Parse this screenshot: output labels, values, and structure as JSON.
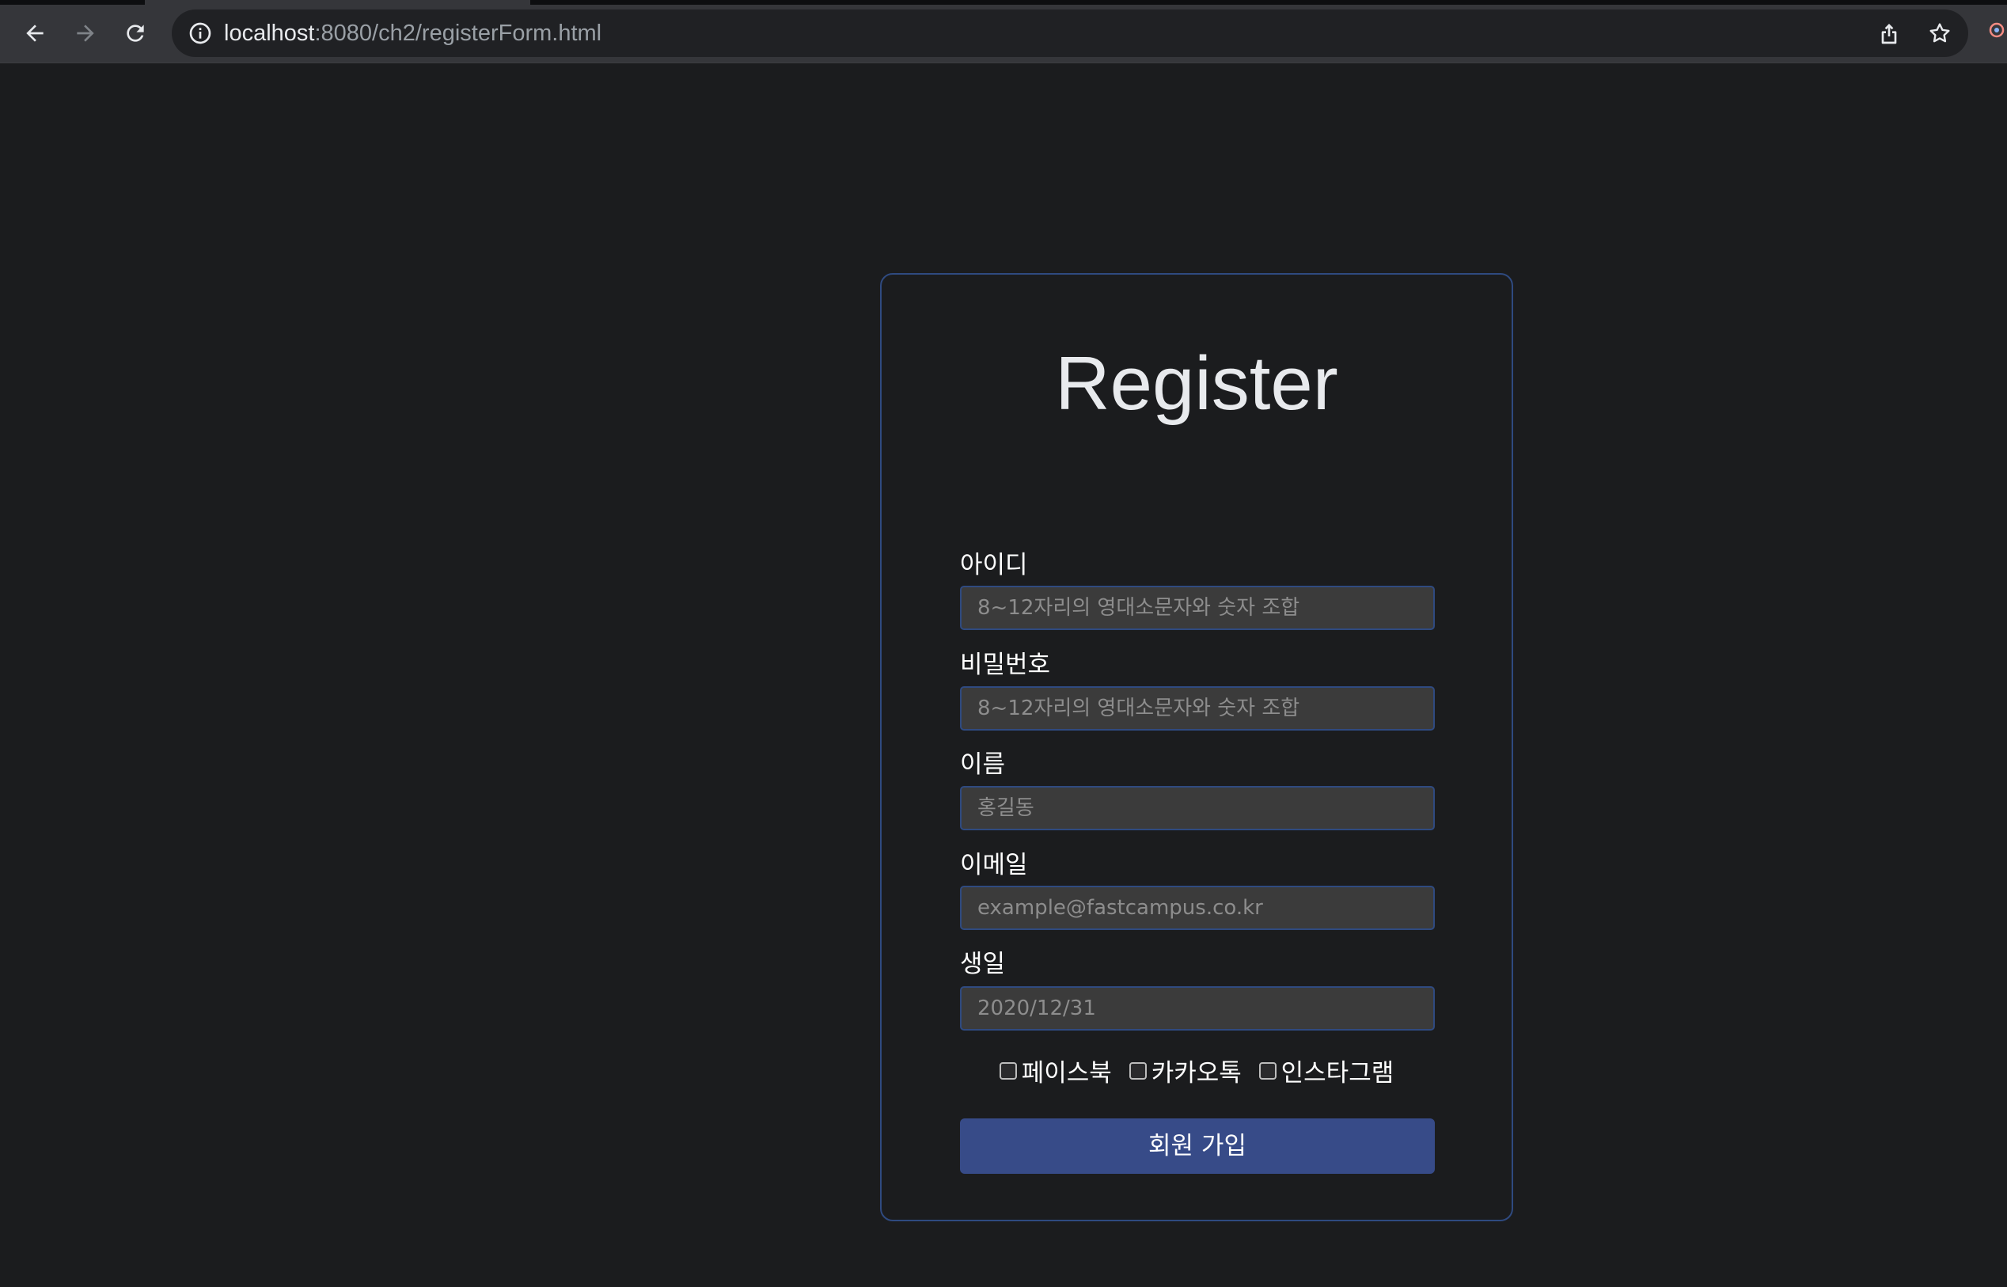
{
  "browser": {
    "url_host": "localhost",
    "url_rest": ":8080/ch2/registerForm.html"
  },
  "form": {
    "title": "Register",
    "fields": [
      {
        "label": "아이디",
        "placeholder": "8~12자리의 영대소문자와 숫자 조합",
        "value": ""
      },
      {
        "label": "비밀번호",
        "placeholder": "8~12자리의 영대소문자와 숫자 조합",
        "value": ""
      },
      {
        "label": "이름",
        "placeholder": "홍길동",
        "value": ""
      },
      {
        "label": "이메일",
        "placeholder": "example@fastcampus.co.kr",
        "value": ""
      },
      {
        "label": "생일",
        "placeholder": "2020/12/31",
        "value": ""
      }
    ],
    "checkboxes": [
      {
        "label": "페이스북",
        "checked": false
      },
      {
        "label": "카카오톡",
        "checked": false
      },
      {
        "label": "인스타그램",
        "checked": false
      }
    ],
    "submit_label": "회원 가입"
  },
  "colors": {
    "page_bg": "#1b1c1e",
    "card_border": "#2f4a80",
    "input_bg": "#3b3b3b",
    "button_bg": "#374b88"
  },
  "icons": [
    "back-arrow-icon",
    "forward-arrow-icon",
    "reload-icon",
    "info-icon",
    "share-icon",
    "star-icon",
    "extension-icon"
  ]
}
